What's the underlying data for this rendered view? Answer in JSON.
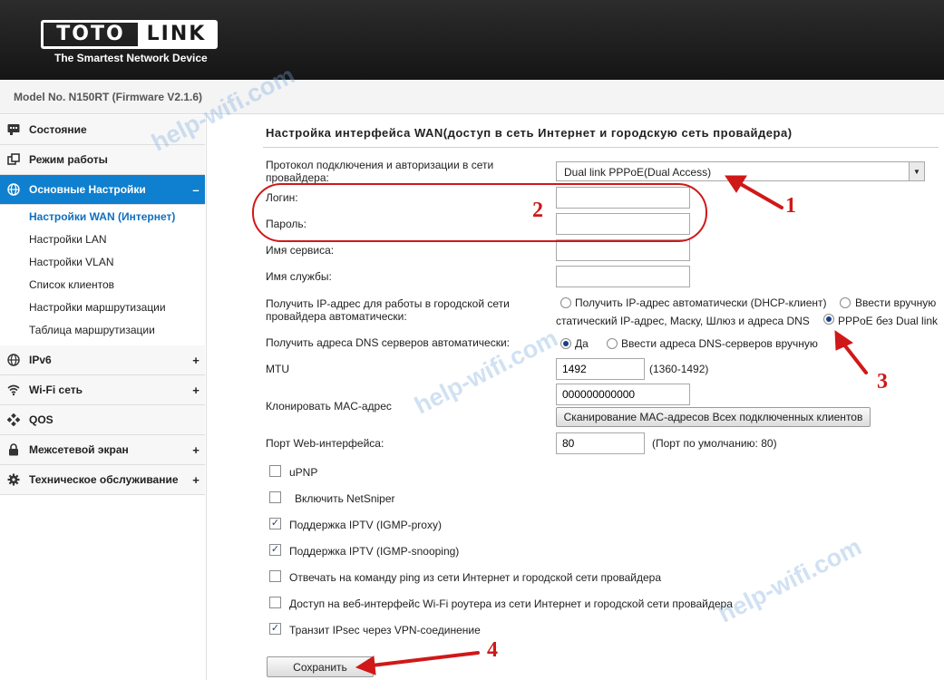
{
  "brand": {
    "logo_left": "TOTO",
    "logo_right": "LINK",
    "tagline": "The Smartest Network Device"
  },
  "model": "Model No. N150RT (Firmware V2.1.6)",
  "sidebar": {
    "items": [
      {
        "label": "Состояние",
        "icon": "status-icon",
        "expander": ""
      },
      {
        "label": "Режим работы",
        "icon": "mode-icon",
        "expander": ""
      },
      {
        "label": "Основные Настройки",
        "icon": "globe-icon",
        "expander": "–"
      },
      {
        "label": "IPv6",
        "icon": "ipv6-globe-icon",
        "expander": "+"
      },
      {
        "label": "Wi-Fi сеть",
        "icon": "wifi-icon",
        "expander": "+"
      },
      {
        "label": "QOS",
        "icon": "qos-icon",
        "expander": ""
      },
      {
        "label": "Межсетевой экран",
        "icon": "lock-icon",
        "expander": "+"
      },
      {
        "label": "Техническое обслуживание",
        "icon": "gear-icon",
        "expander": "+"
      }
    ],
    "subitems": [
      "Настройки WAN (Интернет)",
      "Настройки LAN",
      "Настройки VLAN",
      "Список клиентов",
      "Настройки маршрутизации",
      "Таблица маршрутизации"
    ]
  },
  "main": {
    "title": "Настройка интерфейса WAN(доступ в сеть Интернет и городскую сеть провайдера)",
    "protocol_label_1": "Протокол подключения и авторизации в сети",
    "protocol_label_2": "провайдера:",
    "protocol_value": "Dual link PPPoE(Dual Access)",
    "login_label": "Логин:",
    "login_value": "",
    "password_label": "Пароль:",
    "password_value": "",
    "service_label": "Имя сервиса:",
    "service_value": "",
    "service2_label": "Имя службы:",
    "service2_value": "",
    "ip_label_1": "Получить IP-адрес для работы в городской сети",
    "ip_label_2": "провайдера автоматически:",
    "ip_opt_dhcp": "Получить IP-адрес автоматически (DHCP-клиент)",
    "ip_opt_manual_1": "Ввести вручную",
    "ip_opt_manual_2": "статический IP-адрес, Маску, Шлюз и адреса DNS",
    "ip_opt_pppoe": "PPPoE без Dual link",
    "dns_label": "Получить адреса DNS серверов автоматически:",
    "dns_yes": "Да",
    "dns_manual": "Ввести адреса DNS-серверов вручную",
    "mtu_label": "MTU",
    "mtu_value": "1492",
    "mtu_note": "(1360-1492)",
    "mac_label": "Клонировать MAC-адрес",
    "mac_value": "000000000000",
    "mac_scan_button": "Сканирование MAC-адресов Всех подключенных клиентов",
    "port_label": "Порт Web-интерфейса:",
    "port_value": "80",
    "port_note": "(Порт по умолчанию: 80)",
    "checkboxes": [
      {
        "label": "uPNP",
        "checked": false
      },
      {
        "label": "Включить NetSniper",
        "checked": false
      },
      {
        "label": "Поддержка IPTV (IGMP-proxy)",
        "checked": true
      },
      {
        "label": "Поддержка IPTV (IGMP-snooping)",
        "checked": true
      },
      {
        "label": "Отвечать на команду ping из сети Интернет и городской сети провайдера",
        "checked": false
      },
      {
        "label": "Доступ на веб-интерфейс Wi-Fi роутера из сети Интернет и городской сети провайдера",
        "checked": false
      },
      {
        "label": "Транзит IPsec через VPN-соединение",
        "checked": true
      }
    ],
    "save_button": "Сохранить"
  },
  "annotations": {
    "n1": "1",
    "n2": "2",
    "n3": "3",
    "n4": "4",
    "watermark": "help-wifi.com",
    "color": "#d01818"
  }
}
